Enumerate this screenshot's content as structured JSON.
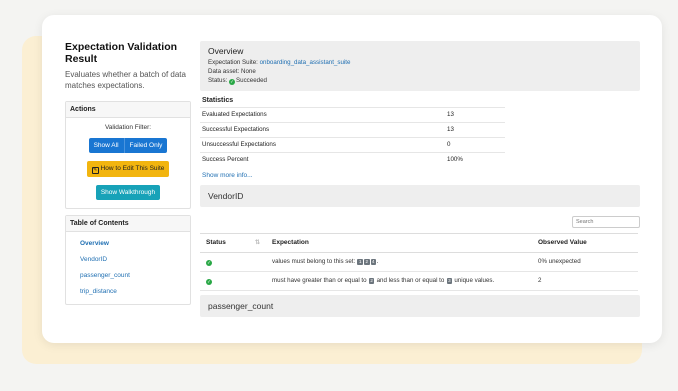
{
  "sidebar": {
    "title": "Expectation Validation Result",
    "description": "Evaluates whether a batch of data matches expectations.",
    "actions_heading": "Actions",
    "filter_label": "Validation Filter:",
    "show_all": "Show All",
    "failed_only": "Failed Only",
    "edit_suite": "How to Edit This Suite",
    "walkthrough": "Show Walkthrough",
    "toc_heading": "Table of Contents",
    "toc": [
      "Overview",
      "VendorID",
      "passenger_count",
      "trip_distance"
    ]
  },
  "overview": {
    "heading": "Overview",
    "suite_label": "Expectation Suite:",
    "suite_name": "onboarding_data_assistant_suite",
    "asset": "Data asset: None",
    "status_label": "Status:",
    "status_value": "Succeeded"
  },
  "statistics": {
    "heading": "Statistics",
    "rows": [
      {
        "label": "Evaluated Expectations",
        "value": "13"
      },
      {
        "label": "Successful Expectations",
        "value": "13"
      },
      {
        "label": "Unsuccessful Expectations",
        "value": "0"
      },
      {
        "label": "Success Percent",
        "value": "100%"
      }
    ],
    "show_more": "Show more info..."
  },
  "section_vendor": "VendorID",
  "search_placeholder": "Search",
  "table": {
    "headers": [
      "Status",
      "Expectation",
      "Observed Value"
    ],
    "rows": [
      {
        "exp_before": "values must belong to this set:",
        "badges": [
          "1",
          "2",
          "4"
        ],
        "exp_after": ".",
        "observed": "0% unexpected"
      },
      {
        "exp_p1": "must have greater than or equal to",
        "badge1": "2",
        "exp_p2": "and less than or equal to",
        "badge2": "3",
        "exp_p3": "unique values.",
        "observed": "2"
      }
    ]
  },
  "section_passenger": "passenger_count",
  "colors": {
    "accent": "#1976d2",
    "warning": "#f2b50f",
    "info": "#17a2b8",
    "success": "#28a745",
    "backdrop": "#fbefd3"
  }
}
